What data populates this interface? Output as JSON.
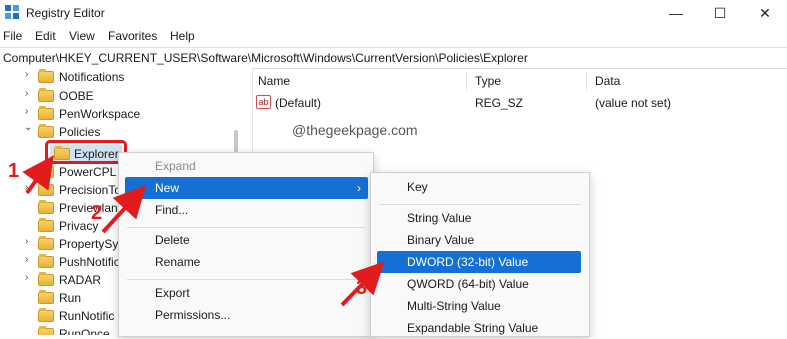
{
  "window": {
    "title": "Registry Editor"
  },
  "window_controls": {
    "minimize": "—",
    "maximize": "☐",
    "close": "✕"
  },
  "menubar": {
    "items": [
      "File",
      "Edit",
      "View",
      "Favorites",
      "Help"
    ]
  },
  "address": {
    "path": "Computer\\HKEY_CURRENT_USER\\Software\\Microsoft\\Windows\\CurrentVersion\\Policies\\Explorer"
  },
  "tree": {
    "items": [
      {
        "label": "Notifications",
        "expander": "›"
      },
      {
        "label": "OOBE",
        "expander": "›"
      },
      {
        "label": "PenWorkspace",
        "expander": "›"
      },
      {
        "label": "Policies",
        "expander": "⌄"
      },
      {
        "label": "Explorer",
        "expander": ""
      },
      {
        "label": "PowerCPL",
        "expander": ""
      },
      {
        "label": "PrecisionTo",
        "expander": "›"
      },
      {
        "label": "Previewlan",
        "expander": ""
      },
      {
        "label": "Privacy",
        "expander": ""
      },
      {
        "label": "PropertySys",
        "expander": "›"
      },
      {
        "label": "PushNotific",
        "expander": "›"
      },
      {
        "label": "RADAR",
        "expander": "›"
      },
      {
        "label": "Run",
        "expander": ""
      },
      {
        "label": "RunNotific",
        "expander": ""
      },
      {
        "label": "RunOnce",
        "expander": ""
      }
    ]
  },
  "list": {
    "columns": [
      "Name",
      "Type",
      "Data"
    ],
    "rows": [
      {
        "icon": "ab",
        "name": "(Default)",
        "type": "REG_SZ",
        "data": "(value not set)"
      }
    ]
  },
  "watermark": "@thegeekpage.com",
  "context_menu": {
    "items": [
      {
        "label": "Expand",
        "disabled": true
      },
      {
        "label": "New",
        "submenu_arrow": "›"
      },
      {
        "label": "Find..."
      },
      {
        "label": "Delete"
      },
      {
        "label": "Rename"
      },
      {
        "label": "Export"
      },
      {
        "label": "Permissions..."
      }
    ]
  },
  "submenu": {
    "items": [
      "Key",
      "String Value",
      "Binary Value",
      "DWORD (32-bit) Value",
      "QWORD (64-bit) Value",
      "Multi-String Value",
      "Expandable String Value"
    ]
  },
  "annotations": {
    "step1": "1",
    "step2": "2",
    "step3": "3"
  },
  "colors": {
    "accent": "#1570d6",
    "annotation": "#e21c1c",
    "selection": "#cfe3f7",
    "folder": "#e8b339"
  },
  "icons": {
    "app": "registry-icon",
    "value": "string-value-icon",
    "folder": "folder-icon"
  }
}
